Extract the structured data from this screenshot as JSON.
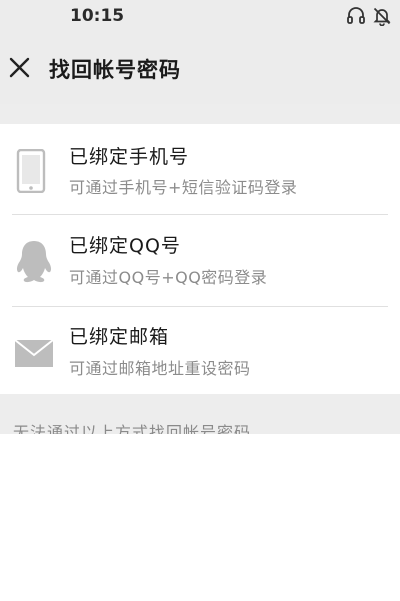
{
  "status_bar": {
    "time": "10:15",
    "icons": [
      "headset-icon",
      "bell-muted-icon"
    ]
  },
  "header": {
    "close_icon": "close-icon",
    "title": "找回帐号密码"
  },
  "options": [
    {
      "icon": "phone-icon",
      "title": "已绑定手机号",
      "description": "可通过手机号+短信验证码登录"
    },
    {
      "icon": "qq-icon",
      "title": "已绑定QQ号",
      "description": "可通过QQ号+QQ密码登录"
    },
    {
      "icon": "mail-icon",
      "title": "已绑定邮箱",
      "description": "可通过邮箱地址重设密码"
    }
  ],
  "footer": {
    "other_methods_text": "无法通过以上方式找回帐号密码"
  },
  "colors": {
    "header_bg": "#ececec",
    "list_bg": "#ffffff",
    "icon_gray": "#bdbdbd",
    "desc_text": "#8c8c8c"
  }
}
